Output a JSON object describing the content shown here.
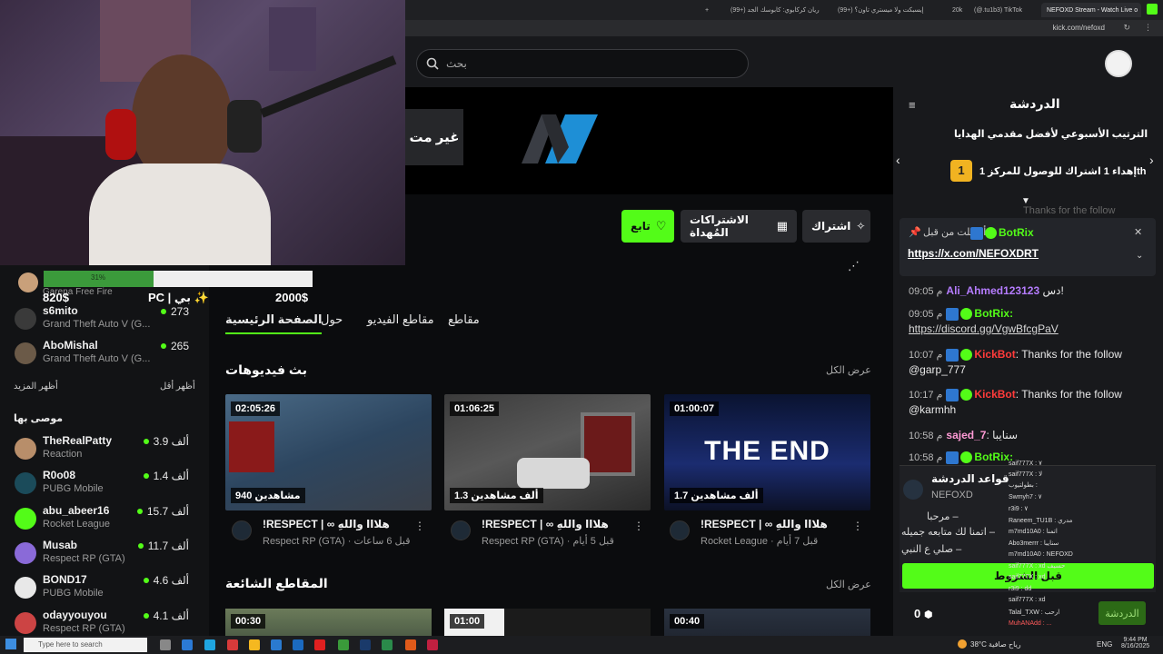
{
  "browser": {
    "tabs": [
      {
        "label": "NEFOXD Stream - Watch Live o"
      },
      {
        "label": "(@.tu1b3) TikTok"
      },
      {
        "label": "20k"
      },
      {
        "label": "(99+) إيسبكت ولا ميستري تاون؟"
      },
      {
        "label": "(99+) ريان كركابوي: كابوسك الجد"
      }
    ],
    "url": "kick.com/nefoxd"
  },
  "header": {
    "search_placeholder": "بحث"
  },
  "banner": {
    "button_label": "غير مت"
  },
  "actions": {
    "follow": "تابع",
    "gift_subs": "الاشتراكات المُهداة",
    "subscribe": "اشتراك"
  },
  "channel_tabs": {
    "home": "الصفحة الرئيسية",
    "about": "حول",
    "videos": "مقاطع الفيديو",
    "clips": "مقاطع"
  },
  "sections": {
    "videos_title": "بث فيديوهات",
    "see_all": "عرض الكل",
    "clips_title": "المقاطع الشائعة",
    "see_all_2": "عرض الكل"
  },
  "videos": [
    {
      "duration": "02:05:26",
      "views": "940 مشاهدين",
      "title": "!RESPECT | ∞ هلااا واللهِ",
      "category": "Respect RP (GTA)",
      "ago": "قبل 6 ساعات"
    },
    {
      "duration": "01:06:25",
      "views": "1.3 ألف مشاهدين",
      "title": "!RESPECT | ∞ هلااا واللهِ",
      "category": "Respect RP (GTA)",
      "ago": "قبل 5 أيام"
    },
    {
      "duration": "01:00:07",
      "views": "1.7 ألف مشاهدين",
      "title": "!RESPECT | ∞ هلااا واللهِ",
      "category": "Rocket League",
      "ago": "قبل 7 أيام",
      "thumb_text": "THE END"
    }
  ],
  "clips": [
    {
      "duration": "00:30"
    },
    {
      "duration": "01:00"
    },
    {
      "duration": "00:40"
    }
  ],
  "goal": {
    "percent_label": "31%",
    "progress": 0.41,
    "current": "820$",
    "target": "2000$",
    "platform": "PC | بي ✨",
    "game_hint": "Garena Free Fire"
  },
  "sidebar": {
    "following": [
      {
        "name": "s6mito",
        "game": "Grand Theft Auto V (G...",
        "count": "273",
        "pre": "تشي"
      },
      {
        "name": "AboMishal",
        "game": "Grand Theft Auto V (G...",
        "count": "265"
      }
    ],
    "show_more": "أظهر المزيد",
    "show_less": "أظهر أقل",
    "recommended_title": "موصى بها",
    "recommended": [
      {
        "name": "TheRealPatty",
        "game": "Reaction",
        "count": "3.9 ألف"
      },
      {
        "name": "R0o08",
        "game": "PUBG Mobile",
        "count": "1.4 ألف"
      },
      {
        "name": "abu_abeer16",
        "game": "Rocket League",
        "count": "15.7 ألف"
      },
      {
        "name": "Musab",
        "game": "Respect RP (GTA)",
        "count": "11.7 ألف"
      },
      {
        "name": "BOND17",
        "game": "PUBG Mobile",
        "count": "4.6 ألف"
      },
      {
        "name": "odayyouyou",
        "game": "Respect RP (GTA)",
        "count": "4.1 ألف"
      }
    ]
  },
  "chat": {
    "title": "الدردشة",
    "leaderboard_title": "الترتيب الأسبوعي لأفضل مقدمي الهدايا",
    "leaderboard_line": "إهداء 1 اشتراك للوصول للمركز 1",
    "leaderboard_suffix": "th",
    "leaderboard_rank": "1",
    "pinned": {
      "user": "BotRix",
      "sent_by": "أرسلت من قبل",
      "link": "https://x.com/NEFOXDRT"
    },
    "faded_line": "Thanks for the follow",
    "messages": [
      {
        "time": "09:05 م",
        "user": "Ali_Ahmed123123",
        "user_color": "#b57cff",
        "text": "دس!",
        "badges": false
      },
      {
        "time": "09:05 م",
        "user": "BotRix:",
        "user_color": "#53fc18",
        "text": "https://discord.gg/VgwBfcgPaV",
        "badges": true,
        "link": true
      },
      {
        "time": "10:07 م",
        "user": "KickBot",
        "user_color": "#ff3b3b",
        "text": ": Thanks for the follow @garp_777",
        "badges": true
      },
      {
        "time": "10:17 م",
        "user": "KickBot",
        "user_color": "#ff3b3b",
        "text": ": Thanks for the follow @karmhh",
        "badges": true
      },
      {
        "time": "10:58 م",
        "user": "sajed_7",
        "user_color": "#ff9ad5",
        "text": ": سنايبا",
        "badges": false
      },
      {
        "time": "10:58 م",
        "user": "BotRix:",
        "user_color": "#53fc18",
        "text": "",
        "badges": true
      }
    ],
    "rules": {
      "title": "قواعد الدردشة",
      "channel": "NEFOXD",
      "lines": [
        "مرحبا –",
        "اتمنا لك متابعه جميله –",
        "صلي ع النبي –"
      ],
      "accept": "قبل الشروط"
    },
    "points": "0",
    "send_button": "الدردشة"
  },
  "overlay_chat": [
    "saif777X : ٧",
    "saif777X : لا",
    "بطولتيوب :",
    "Swmyh7 : ٧",
    "r3i9 : ٧",
    "Raneem_TU1B : مدري",
    "m7md10A0 : اتمنا",
    "Abo3merrr : سنايبا",
    "m7md10A0 : NEFOXD",
    "saif777X : xd حسيف",
    "saif777X : xd",
    "r3i9 : dd",
    "saif777X : xd",
    "Talal_TXW : ارحب",
    "MuhANAdd : ...",
    "102938 : ..."
  ],
  "taskbar": {
    "search": "Type here to search",
    "temp": "38°C",
    "weather_text": "رياح صافية",
    "lang": "ENG",
    "time": "9:44 PM",
    "date": "8/16/2025"
  },
  "colors": {
    "brand": "#53fc18",
    "bg": "#0b0c0e",
    "panel": "#18191c"
  }
}
